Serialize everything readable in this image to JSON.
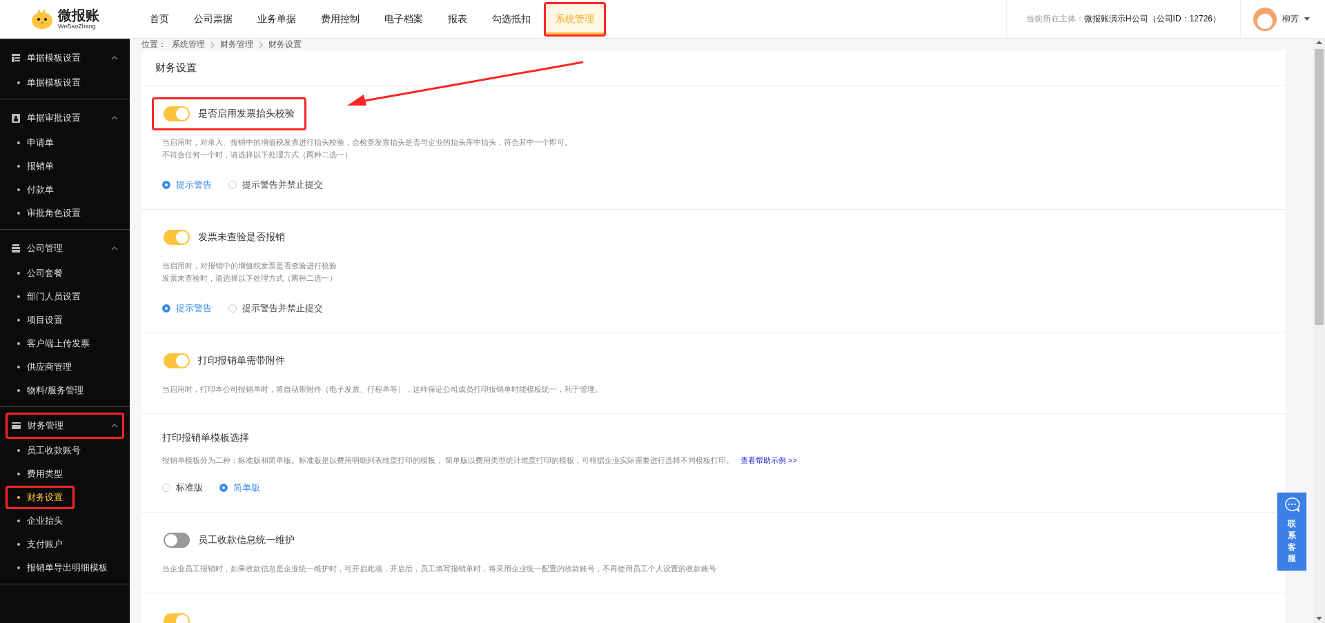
{
  "header": {
    "logo_text": "微报账",
    "logo_subtext": "WeBaoZhang",
    "nav": [
      {
        "label": "首页",
        "selected": false,
        "highlighted": false
      },
      {
        "label": "公司票据",
        "selected": false,
        "highlighted": false
      },
      {
        "label": "业务单据",
        "selected": false,
        "highlighted": false
      },
      {
        "label": "费用控制",
        "selected": false,
        "highlighted": false
      },
      {
        "label": "电子档案",
        "selected": false,
        "highlighted": false
      },
      {
        "label": "报表",
        "selected": false,
        "highlighted": false
      },
      {
        "label": "勾选抵扣",
        "selected": false,
        "highlighted": false
      },
      {
        "label": "系统管理",
        "selected": true,
        "highlighted": true
      }
    ],
    "entity_label": "当前所在主体：",
    "entity_value": "微报账演示H公司（公司ID：12726）",
    "username": "柳芳"
  },
  "sidebar": {
    "groups": [
      {
        "title": "单据模板设置",
        "expanded": true,
        "highlighted": false,
        "items": [
          {
            "label": "单据模板设置",
            "selected": false,
            "highlighted": false
          }
        ]
      },
      {
        "title": "单据审批设置",
        "expanded": true,
        "highlighted": false,
        "items": [
          {
            "label": "申请单",
            "selected": false,
            "highlighted": false
          },
          {
            "label": "报销单",
            "selected": false,
            "highlighted": false
          },
          {
            "label": "付款单",
            "selected": false,
            "highlighted": false
          },
          {
            "label": "审批角色设置",
            "selected": false,
            "highlighted": false
          }
        ]
      },
      {
        "title": "公司管理",
        "expanded": true,
        "highlighted": false,
        "items": [
          {
            "label": "公司套餐",
            "selected": false,
            "highlighted": false
          },
          {
            "label": "部门人员设置",
            "selected": false,
            "highlighted": false
          },
          {
            "label": "项目设置",
            "selected": false,
            "highlighted": false
          },
          {
            "label": "客户端上传发票",
            "selected": false,
            "highlighted": false
          },
          {
            "label": "供应商管理",
            "selected": false,
            "highlighted": false
          },
          {
            "label": "物料/服务管理",
            "selected": false,
            "highlighted": false
          }
        ]
      },
      {
        "title": "财务管理",
        "expanded": true,
        "highlighted": true,
        "items": [
          {
            "label": "员工收款账号",
            "selected": false,
            "highlighted": false
          },
          {
            "label": "费用类型",
            "selected": false,
            "highlighted": false
          },
          {
            "label": "财务设置",
            "selected": true,
            "highlighted": true
          },
          {
            "label": "企业抬头",
            "selected": false,
            "highlighted": false
          },
          {
            "label": "支付账户",
            "selected": false,
            "highlighted": false
          },
          {
            "label": "报销单导出明细模板",
            "selected": false,
            "highlighted": false
          }
        ]
      }
    ]
  },
  "breadcrumb": {
    "label": "位置：",
    "items": [
      "系统管理",
      "财务管理",
      "财务设置"
    ]
  },
  "card": {
    "title": "财务设置",
    "settings": [
      {
        "kind": "toggle",
        "title": "是否启用发票抬头校验",
        "on": true,
        "highlighted": true,
        "description": [
          "当启用时，对录入、报销中的增值税发票进行抬头校验，会检查发票抬头是否与企业的抬头库中抬头，符合其中一个即可。",
          "不符合任何一个时，请选择以下处理方式（两种二选一）"
        ],
        "options": [
          {
            "label": "提示警告",
            "selected": true
          },
          {
            "label": "提示警告并禁止提交",
            "selected": false
          }
        ]
      },
      {
        "kind": "toggle",
        "title": "发票未查验是否报销",
        "on": true,
        "highlighted": false,
        "description": [
          "当启用时，对报销中的增值税发票是否查验进行校验",
          "发票未查验时，请选择以下处理方式（两种二选一）"
        ],
        "options": [
          {
            "label": "提示警告",
            "selected": true
          },
          {
            "label": "提示警告并禁止提交",
            "selected": false
          }
        ]
      },
      {
        "kind": "toggle",
        "title": "打印报销单需带附件",
        "on": true,
        "highlighted": false,
        "description": [
          "当启用时，打印本公司报销单时，将自动带附件（电子发票、行程单等），这样保证公司成员打印报销单时能模板统一，利于管理。"
        ]
      },
      {
        "kind": "plain",
        "title": "打印报销单模板选择",
        "description": [
          "报销单模板分为二种：标准版和简单版。标准版是以费用明细列表维度打印的模板， 简单版以费用类型统计维度打印的模板，可根据企业实际需要进行选择不同模板打印。"
        ],
        "link": "查看帮助示例 >>",
        "options": [
          {
            "label": "标准版",
            "selected": false
          },
          {
            "label": "简单版",
            "selected": true
          }
        ]
      },
      {
        "kind": "toggle",
        "title": "员工收款信息统一维护",
        "on": false,
        "highlighted": false,
        "description": [
          "当企业员工报销时，如果收款信息是企业统一维护时，可开启此项，开启后，员工填写报销单时，将采用企业统一配置的收款账号，不再使用员工个人设置的收款账号"
        ]
      },
      {
        "kind": "toggle",
        "on": true,
        "highlighted": false
      }
    ]
  },
  "chat_button": {
    "label": "联系客服"
  }
}
